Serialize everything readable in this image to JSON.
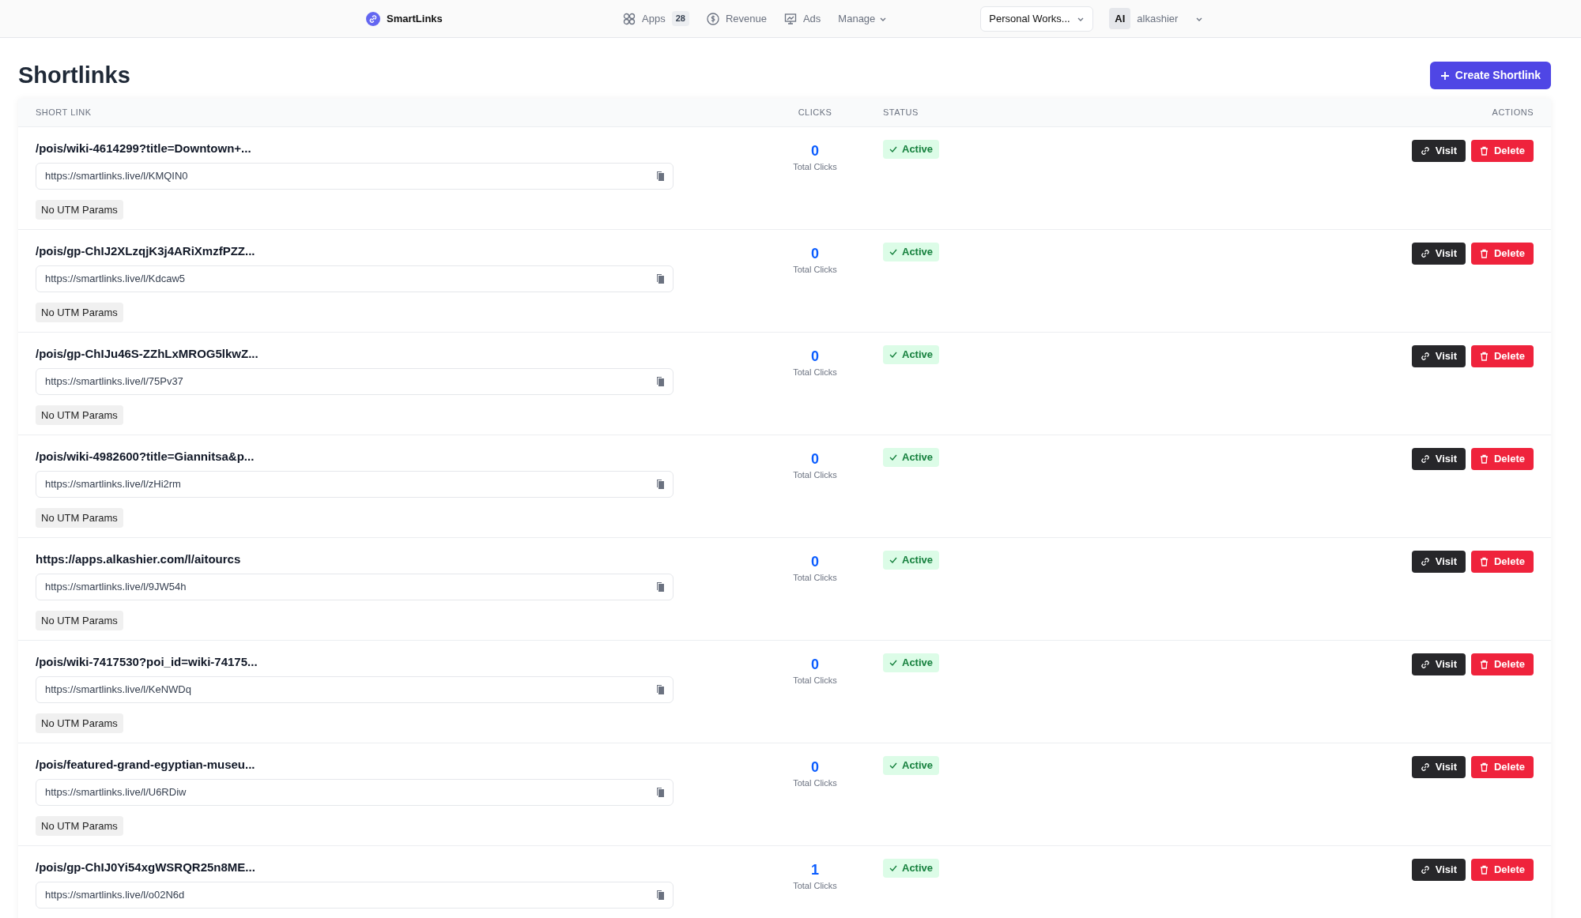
{
  "nav": {
    "brand": "SmartLinks",
    "items": [
      {
        "kind": "apps",
        "label": "Apps",
        "count": "28"
      },
      {
        "kind": "revenue",
        "label": "Revenue"
      },
      {
        "kind": "ads",
        "label": "Ads"
      },
      {
        "kind": "dropdown",
        "label": "Manage"
      }
    ],
    "workspace": "Personal Works...",
    "avatar": "AI",
    "user": "alkashier"
  },
  "page": {
    "title": "Shortlinks",
    "create_button": "Create Shortlink"
  },
  "table": {
    "columns": [
      "SHORT LINK",
      "CLICKS",
      "STATUS",
      "ACTIONS"
    ],
    "rows": [
      {
        "title": "/pois/wiki-4614299?title=Downtown+...",
        "url": "https://smartlinks.live/l/KMQIN0",
        "utm": "No UTM Params",
        "clicks": "0",
        "clicks_label": "Total Clicks",
        "status": {
          "kind": "active",
          "label": "Active"
        },
        "actions": [
          "Visit",
          "Delete"
        ]
      },
      {
        "title": "/pois/gp-ChIJ2XLzqjK3j4ARiXmzfPZZ...",
        "url": "https://smartlinks.live/l/Kdcaw5",
        "utm": "No UTM Params",
        "clicks": "0",
        "clicks_label": "Total Clicks",
        "status": {
          "kind": "active",
          "label": "Active"
        },
        "actions": [
          "Visit",
          "Delete"
        ]
      },
      {
        "title": "/pois/gp-ChIJu46S-ZZhLxMROG5lkwZ...",
        "url": "https://smartlinks.live/l/75Pv37",
        "utm": "No UTM Params",
        "clicks": "0",
        "clicks_label": "Total Clicks",
        "status": {
          "kind": "active",
          "label": "Active"
        },
        "actions": [
          "Visit",
          "Delete"
        ]
      },
      {
        "title": "/pois/wiki-4982600?title=Giannitsa&p...",
        "url": "https://smartlinks.live/l/zHi2rm",
        "utm": "No UTM Params",
        "clicks": "0",
        "clicks_label": "Total Clicks",
        "status": {
          "kind": "active",
          "label": "Active"
        },
        "actions": [
          "Visit",
          "Delete"
        ]
      },
      {
        "title": "https://apps.alkashier.com/l/aitourcs",
        "url": "https://smartlinks.live/l/9JW54h",
        "utm": "No UTM Params",
        "clicks": "0",
        "clicks_label": "Total Clicks",
        "status": {
          "kind": "active",
          "label": "Active"
        },
        "actions": [
          "Visit",
          "Delete"
        ]
      },
      {
        "title": "/pois/wiki-7417530?poi_id=wiki-74175...",
        "url": "https://smartlinks.live/l/KeNWDq",
        "utm": "No UTM Params",
        "clicks": "0",
        "clicks_label": "Total Clicks",
        "status": {
          "kind": "active",
          "label": "Active"
        },
        "actions": [
          "Visit",
          "Delete"
        ]
      },
      {
        "title": "/pois/featured-grand-egyptian-museu...",
        "url": "https://smartlinks.live/l/U6RDiw",
        "utm": "No UTM Params",
        "clicks": "0",
        "clicks_label": "Total Clicks",
        "status": {
          "kind": "active",
          "label": "Active"
        },
        "actions": [
          "Visit",
          "Delete"
        ]
      },
      {
        "title": "/pois/gp-ChIJ0Yi54xgWSRQR25n8ME...",
        "url": "https://smartlinks.live/l/o02N6d",
        "clicks": "1",
        "clicks_label": "Total Clicks",
        "status": {
          "kind": "active",
          "label": "Active"
        },
        "actions": [
          "Visit",
          "Delete"
        ]
      }
    ]
  }
}
